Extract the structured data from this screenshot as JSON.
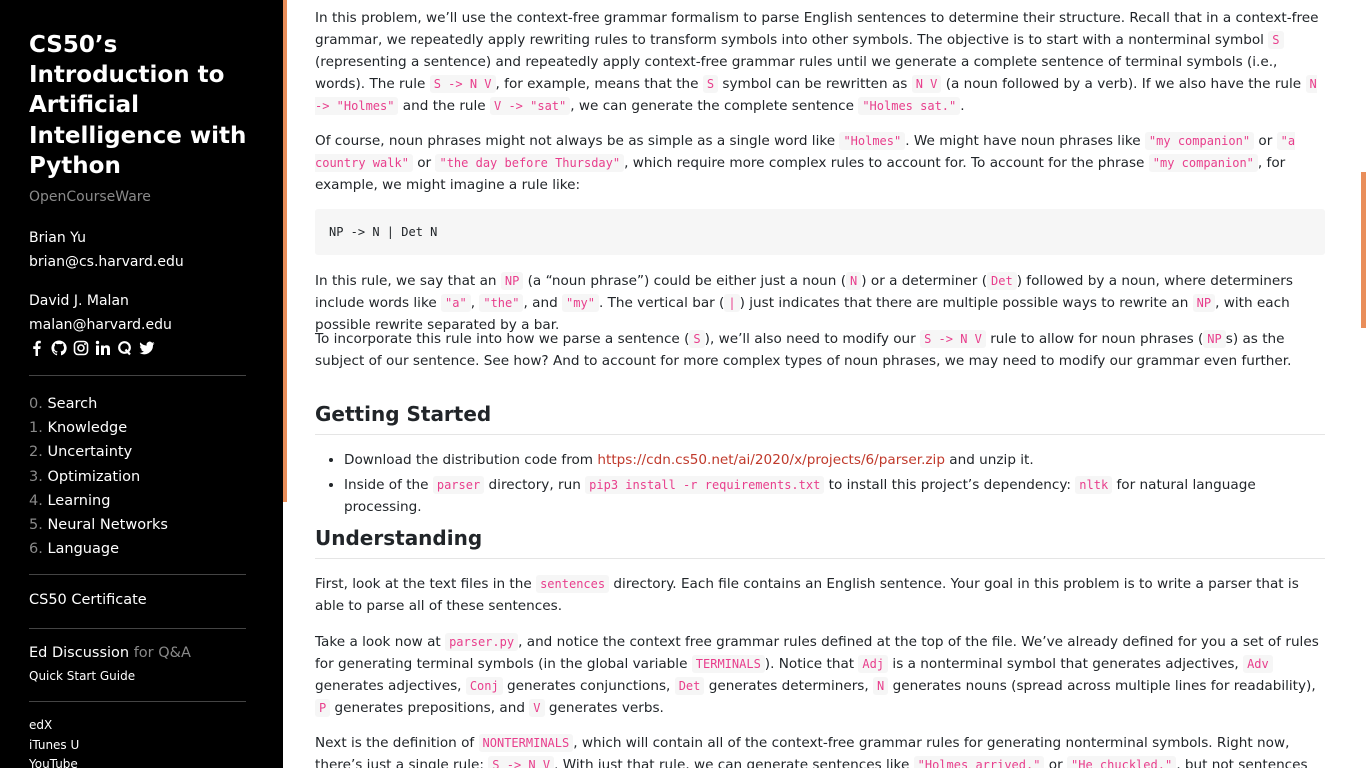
{
  "sidebar": {
    "course_title": "CS50’s Introduction to Artificial Intelligence with Python",
    "subtitle": "OpenCourseWare",
    "instructors": [
      {
        "name": "Brian Yu",
        "email": "brian@cs.harvard.edu"
      },
      {
        "name": "David J. Malan",
        "email": "malan@harvard.edu"
      }
    ],
    "social_icons": [
      "facebook-icon",
      "github-icon",
      "instagram-icon",
      "linkedin-icon",
      "quora-icon",
      "twitter-icon"
    ],
    "nav": [
      {
        "num": "0.",
        "label": "Search"
      },
      {
        "num": "1.",
        "label": "Knowledge"
      },
      {
        "num": "2.",
        "label": "Uncertainty"
      },
      {
        "num": "3.",
        "label": "Optimization"
      },
      {
        "num": "4.",
        "label": "Learning"
      },
      {
        "num": "5.",
        "label": "Neural Networks"
      },
      {
        "num": "6.",
        "label": "Language"
      }
    ],
    "certificate": "CS50 Certificate",
    "ed_discussion": "Ed Discussion",
    "ed_for": " for Q&A",
    "quick_start": "Quick Start Guide",
    "links": [
      "edX",
      "iTunes U",
      "YouTube"
    ]
  },
  "content": {
    "p1": {
      "t1": "In this problem, we’ll use the context-free grammar formalism to parse English sentences to determine their structure. Recall that in a context-free grammar, we repeatedly apply rewriting rules to transform symbols into other symbols. The objective is to start with a nonterminal symbol ",
      "c1": "S",
      "t2": " (representing a sentence) and repeatedly apply context-free grammar rules until we generate a complete sentence of terminal symbols (i.e., words). The rule ",
      "c2": "S -> N V",
      "t3": ", for example, means that the ",
      "c3": "S",
      "t4": " symbol can be rewritten as ",
      "c4": "N V",
      "t5": " (a noun followed by a verb). If we also have the rule ",
      "c5": "N -> \"Holmes\"",
      "t6": " and the rule ",
      "c6": "V -> \"sat\"",
      "t7": ", we can generate the complete sentence ",
      "c7": "\"Holmes sat.\"",
      "t8": "."
    },
    "p2": {
      "t1": "Of course, noun phrases might not always be as simple as a single word like ",
      "c1": "\"Holmes\"",
      "t2": ". We might have noun phrases like ",
      "c2": "\"my companion\"",
      "t3": " or ",
      "c3": "\"a country walk\"",
      "t4": " or ",
      "c4": "\"the day before Thursday\"",
      "t5": ", which require more complex rules to account for. To account for the phrase ",
      "c5": "\"my companion\"",
      "t6": ", for example, we might imagine a rule like:"
    },
    "code_block": "NP -> N | Det N",
    "p3": {
      "t1": "In this rule, we say that an ",
      "c1": "NP",
      "t2": " (a “noun phrase”) could be either just a noun (",
      "c2": "N",
      "t3": ") or a determiner (",
      "c3": "Det",
      "t4": ") followed by a noun, where determiners include words like ",
      "c4": "\"a\"",
      "t5": ", ",
      "c5": "\"the\"",
      "t6": ", and ",
      "c6": "\"my\"",
      "t7": ". The vertical bar (",
      "c7": "|",
      "t8": ") just indicates that there are multiple possible ways to rewrite an ",
      "c8": "NP",
      "t9": ", with each possible rewrite separated by a bar."
    },
    "p4": {
      "t1": "To incorporate this rule into how we parse a sentence (",
      "c1": "S",
      "t2": "), we’ll also need to modify our ",
      "c2": "S -> N V",
      "t3": " rule to allow for noun phrases (",
      "c3": "NP",
      "t4": "s) as the subject of our sentence. See how? And to account for more complex types of noun phrases, we may need to modify our grammar even further."
    },
    "h_getting_started": "Getting Started",
    "gs_items": {
      "i1_t1": "Download the distribution code from ",
      "i1_link": "https://cdn.cs50.net/ai/2020/x/projects/6/parser.zip",
      "i1_t2": " and unzip it.",
      "i2_t1": "Inside of the ",
      "i2_c1": "parser",
      "i2_t2": " directory, run ",
      "i2_c2": "pip3 install -r requirements.txt",
      "i2_t3": " to install this project’s dependency: ",
      "i2_c3": "nltk",
      "i2_t4": " for natural language processing."
    },
    "h_understanding": "Understanding",
    "p5": {
      "t1": "First, look at the text files in the ",
      "c1": "sentences",
      "t2": " directory. Each file contains an English sentence. Your goal in this problem is to write a parser that is able to parse all of these sentences."
    },
    "p6": {
      "t1": "Take a look now at ",
      "c1": "parser.py",
      "t2": ", and notice the context free grammar rules defined at the top of the file. We’ve already defined for you a set of rules for generating terminal symbols (in the global variable ",
      "c2": "TERMINALS",
      "t3": "). Notice that ",
      "c3": "Adj",
      "t4": " is a nonterminal symbol that generates adjectives, ",
      "c4": "Adv",
      "t5": " generates adjectives, ",
      "c5": "Conj",
      "t6": " generates conjunctions, ",
      "c6": "Det",
      "t7": " generates determiners, ",
      "c7": "N",
      "t8": " generates nouns (spread across multiple lines for readability), ",
      "c8": "P",
      "t9": " generates prepositions, and ",
      "c9": "V",
      "t10": " generates verbs."
    },
    "p7": {
      "t1": "Next is the definition of ",
      "c1": "NONTERMINALS",
      "t2": ", which will contain all of the context-free grammar rules for generating nonterminal symbols. Right now, there’s just a single rule: ",
      "c2": "S -> N V",
      "t3": ". With just that rule, we can generate sentences like ",
      "c3": "\"Holmes arrived.\"",
      "t4": " or ",
      "c4": "\"He chuckled.\"",
      "t5": ", but not sentences more complex than that."
    }
  },
  "colors": {
    "accent": "#e98e5a",
    "code": "#e83e8c",
    "link": "#c0392b"
  }
}
